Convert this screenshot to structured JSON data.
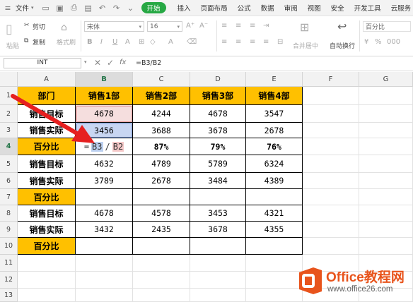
{
  "menu": {
    "file": "文件",
    "tabs": [
      "插入",
      "页面布局",
      "公式",
      "数据",
      "审阅",
      "视图",
      "安全",
      "开发工具",
      "云服务"
    ],
    "start_tab": "开始"
  },
  "toolbar": {
    "cut": "剪切",
    "copy": "复制",
    "paste": "粘贴",
    "format_painter": "格式刷",
    "font_name": "宋体",
    "font_size": "16",
    "merge_center": "合并居中",
    "auto_wrap": "自动换行",
    "number_format": "百分比"
  },
  "formula_bar": {
    "name_box": "INT",
    "fx": "fx",
    "formula": "=B3/B2"
  },
  "columns": [
    "A",
    "B",
    "C",
    "D",
    "E",
    "F",
    "G"
  ],
  "rows": [
    "1",
    "2",
    "3",
    "4",
    "5",
    "6",
    "7",
    "8",
    "9",
    "10",
    "11",
    "12",
    "13"
  ],
  "table": {
    "headers": [
      "部门",
      "销售1部",
      "销售2部",
      "销售3部",
      "销售4部"
    ],
    "rows": [
      [
        "销售目标",
        "4678",
        "4244",
        "4678",
        "3547"
      ],
      [
        "销售实际",
        "3456",
        "3688",
        "3678",
        "2678"
      ],
      [
        "百分比",
        "",
        "87%",
        "79%",
        "76%"
      ],
      [
        "销售目标",
        "4632",
        "4789",
        "5789",
        "6324"
      ],
      [
        "销售实际",
        "3789",
        "2678",
        "3484",
        "4389"
      ],
      [
        "百分比",
        "",
        "",
        "",
        ""
      ],
      [
        "销售目标",
        "4678",
        "4578",
        "3453",
        "4321"
      ],
      [
        "销售实际",
        "3432",
        "2435",
        "3678",
        "4355"
      ],
      [
        "百分比",
        "",
        "",
        "",
        ""
      ]
    ]
  },
  "editing_cell": {
    "eq": "=",
    "ref1": "B3",
    "slash": "/",
    "ref2": "B2"
  },
  "watermark": {
    "brand": "Office教程网",
    "url": "www.office26.com"
  },
  "colors": {
    "header_fill": "#ffc000",
    "start_tab": "#27a844",
    "ref_red": "#e8a0a0",
    "ref_blue": "#9fb8e8",
    "watermark_orange": "#e8541c"
  }
}
